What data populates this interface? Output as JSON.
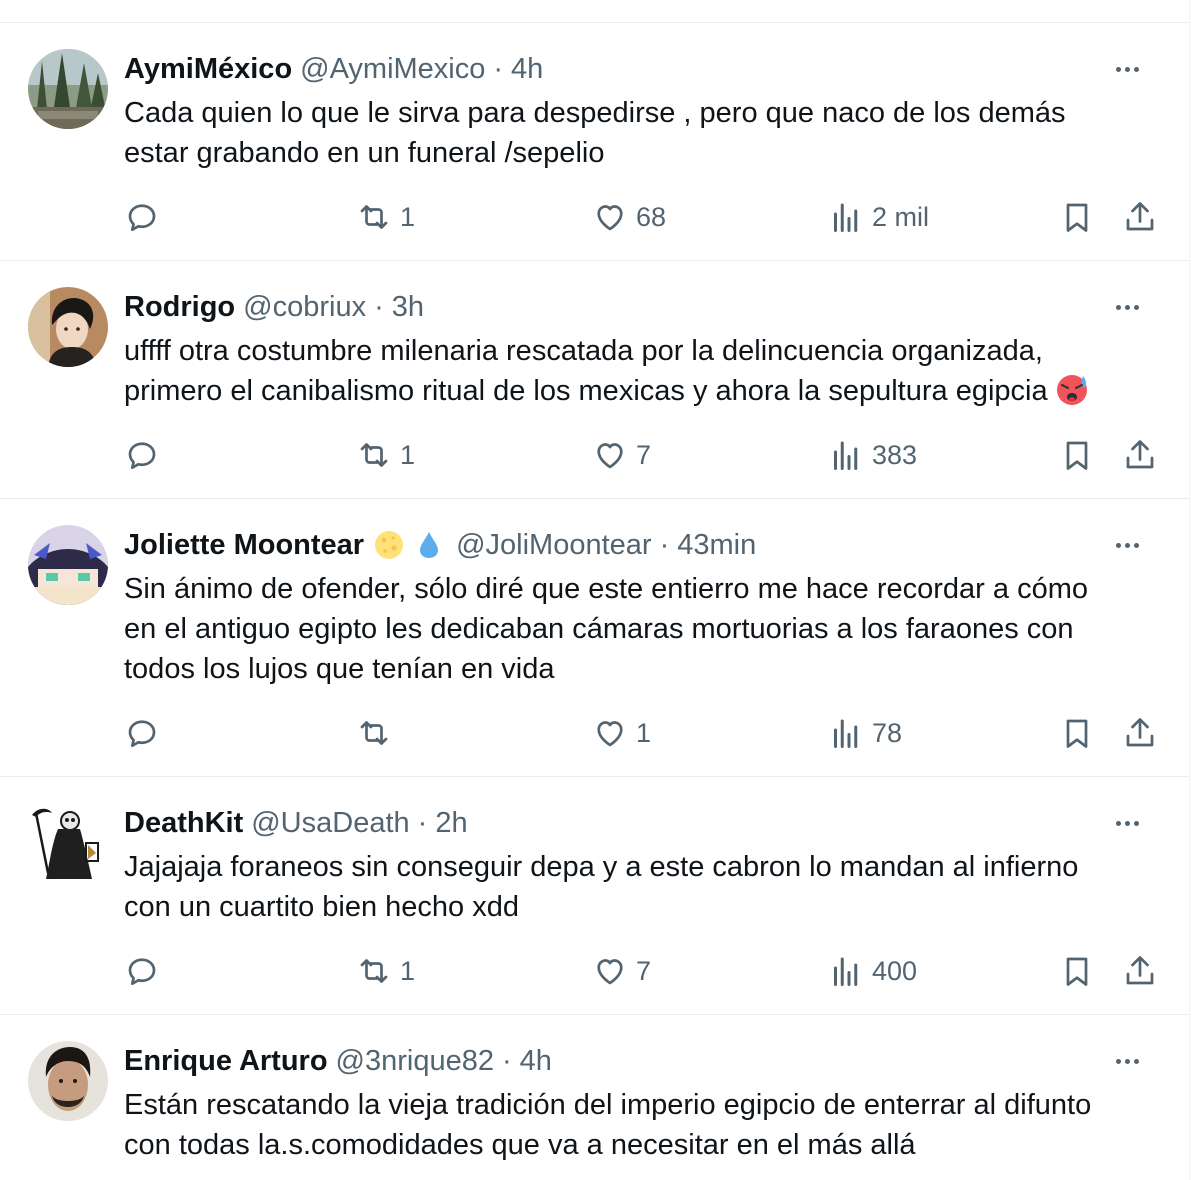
{
  "tweets": [
    {
      "name": "AymiMéxico",
      "handle": "@AymiMexico",
      "separator": "·",
      "time": "4h",
      "lines": [
        "Cada quien lo que le sirva para despedirse , pero que naco de los demás",
        "estar grabando en un funeral /sepelio"
      ],
      "reply_count": "",
      "retweet_count": "1",
      "like_count": "68",
      "view_count": "2 mil",
      "avatar": "landscape-photo"
    },
    {
      "name": "Rodrigo",
      "handle": "@cobriux",
      "separator": "·",
      "time": "3h",
      "lines": [
        "uffff otra costumbre milenaria rescatada por la delincuencia organizada,",
        "primero el canibalismo ritual de los mexicas y ahora la sepultura egipcia"
      ],
      "trailing_emoji": "hot-face-emoji",
      "reply_count": "",
      "retweet_count": "1",
      "like_count": "7",
      "view_count": "383",
      "avatar": "person-photo"
    },
    {
      "name": "Joliette Moontear",
      "name_emojis": [
        "moon-emoji",
        "droplet-emoji"
      ],
      "handle": "@JoliMoontear",
      "separator": "·",
      "time": "43min",
      "lines": [
        "Sin ánimo de ofender, sólo diré que este entierro me hace recordar a cómo",
        "en el antiguo egipto les dedicaban cámaras mortuorias a los faraones con",
        "todos los lujos que tenían en vida"
      ],
      "reply_count": "",
      "retweet_count": "",
      "like_count": "1",
      "view_count": "78",
      "avatar": "anime-drawing"
    },
    {
      "name": "DeathKit",
      "handle": "@UsaDeath",
      "separator": "·",
      "time": "2h",
      "lines": [
        "Jajajaja foraneos sin conseguir depa y a este cabron lo mandan al infierno",
        "con un cuartito bien hecho xdd"
      ],
      "reply_count": "",
      "retweet_count": "1",
      "like_count": "7",
      "view_count": "400",
      "avatar": "grim-reaper-drawing"
    },
    {
      "name": "Enrique Arturo",
      "handle": "@3nrique82",
      "separator": "·",
      "time": "4h",
      "lines": [
        "Están rescatando la vieja tradición del imperio egipcio de enterrar al difunto",
        "con todas la.s.comodidades que va a necesitar en el más allá"
      ],
      "avatar": "person-photo"
    }
  ],
  "colors": {
    "text_primary": "#0f1419",
    "text_secondary": "#536471",
    "divider": "#e6ecf0"
  }
}
